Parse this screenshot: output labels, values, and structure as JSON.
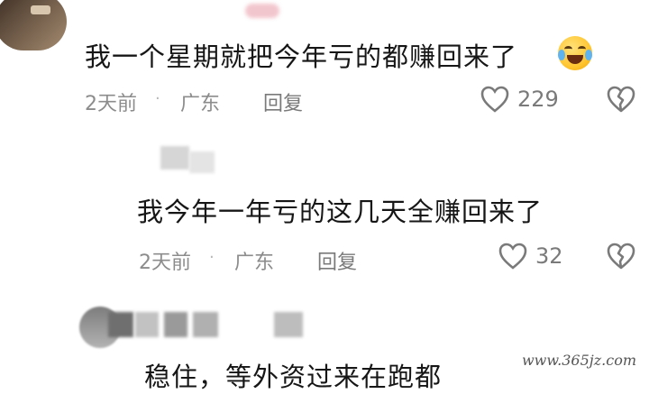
{
  "comments": [
    {
      "text": "我一个星期就把今年亏的都赚回来了",
      "emoji": "rofl-emoji",
      "time": "2天前",
      "separator": "·",
      "location": "广东",
      "reply_label": "回复",
      "likes": "229"
    },
    {
      "text": "我今年一年亏的这几天全赚回来了",
      "time": "2天前",
      "separator": "·",
      "location": "广东",
      "reply_label": "回复",
      "likes": "32"
    },
    {
      "text": "稳住，等外资过来在跑都"
    }
  ],
  "watermark": "www.365jz.com",
  "colors": {
    "text": "#161616",
    "meta": "#8c8c8c",
    "icon": "#7a7a7a"
  },
  "icons": [
    "heart-icon",
    "broken-heart-icon"
  ]
}
